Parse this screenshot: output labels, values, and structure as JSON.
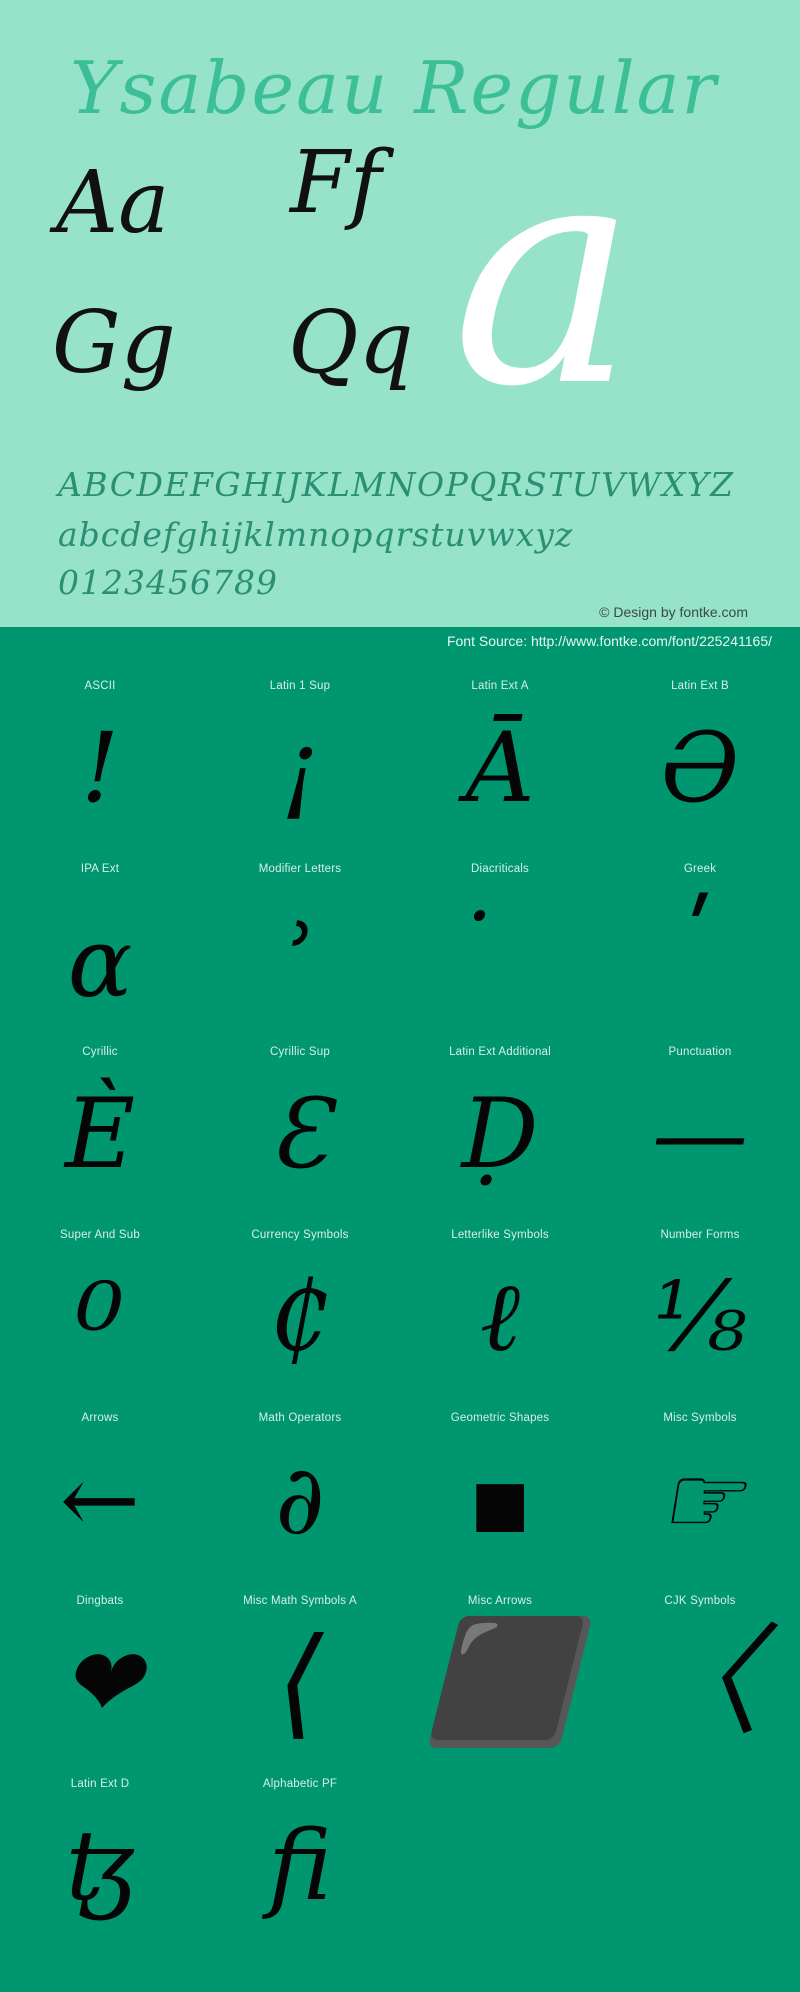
{
  "specimen": {
    "title": "Ysabeau Regular",
    "letter_pairs": [
      "Aa",
      "Ff",
      "Gg",
      "Qq"
    ],
    "feature_glyph": "a",
    "uppercase": "ABCDEFGHIJKLMNOPQRSTUVWXYZ",
    "lowercase": "abcdefghijklmnopqrstuvwxyz",
    "digits": "0123456789",
    "copyright": "© Design by fontke.com",
    "colors": {
      "panel_bg": "#96e3ca",
      "title": "#3cbf96",
      "alphabet": "#2b8f72",
      "glyph": "#111111",
      "feature_glyph": "#ffffff",
      "grid_bg": "#009770",
      "grid_label": "#d8efe6"
    }
  },
  "source_bar": {
    "text": "Font Source: http://www.fontke.com/font/225241165/"
  },
  "grid": {
    "rows": [
      [
        {
          "label": "ASCII",
          "glyph": "!",
          "size": "lg",
          "shift": ""
        },
        {
          "label": "Latin 1 Sup",
          "glyph": "¡",
          "size": "lg",
          "shift": ""
        },
        {
          "label": "Latin Ext A",
          "glyph": "Ā",
          "size": "lg",
          "shift": ""
        },
        {
          "label": "Latin Ext B",
          "glyph": "Ə",
          "size": "lg",
          "shift": ""
        }
      ],
      [
        {
          "label": "IPA Ext",
          "glyph": "ɑ",
          "size": "lg",
          "shift": "glyph-shift-down"
        },
        {
          "label": "Modifier Letters",
          "glyph": "˒",
          "size": "lg",
          "shift": "glyph-shift-up"
        },
        {
          "label": "Diacriticals",
          "glyph": "̇",
          "size": "lg",
          "shift": ""
        },
        {
          "label": "Greek",
          "glyph": "ʹ",
          "size": "lg",
          "shift": "glyph-shift-up"
        }
      ],
      [
        {
          "label": "Cyrillic",
          "glyph": "Ѐ",
          "size": "lg",
          "shift": ""
        },
        {
          "label": "Cyrillic Sup",
          "glyph": "Ɛ",
          "size": "lg",
          "shift": ""
        },
        {
          "label": "Latin Ext Additional",
          "glyph": "Ḍ",
          "size": "lg",
          "shift": ""
        },
        {
          "label": "Punctuation",
          "glyph": "—",
          "size": "lg",
          "shift": ""
        }
      ],
      [
        {
          "label": "Super And Sub",
          "glyph": "⁰",
          "size": "xl",
          "shift": "glyph-shift-down"
        },
        {
          "label": "Currency Symbols",
          "glyph": "₵",
          "size": "lg",
          "shift": ""
        },
        {
          "label": "Letterlike Symbols",
          "glyph": "ℓ",
          "size": "lg",
          "shift": ""
        },
        {
          "label": "Number Forms",
          "glyph": "⅛",
          "size": "lg",
          "shift": ""
        }
      ],
      [
        {
          "label": "Arrows",
          "glyph": "←",
          "size": "lg",
          "shift": ""
        },
        {
          "label": "Math Operators",
          "glyph": "∂",
          "size": "lg",
          "shift": ""
        },
        {
          "label": "Geometric Shapes",
          "glyph": "▪",
          "size": "lg",
          "shift": ""
        },
        {
          "label": "Misc Symbols",
          "glyph": "☞",
          "size": "lg",
          "shift": ""
        }
      ],
      [
        {
          "label": "Dingbats",
          "glyph": "❤",
          "size": "lg",
          "shift": ""
        },
        {
          "label": "Misc Math Symbols A",
          "glyph": "⟨",
          "size": "xl",
          "shift": ""
        },
        {
          "label": "Misc Arrows",
          "glyph": "⬛",
          "size": "xl",
          "shift": ""
        },
        {
          "label": "CJK Symbols",
          "glyph": "〈",
          "size": "xl",
          "shift": ""
        }
      ],
      [
        {
          "label": "Latin Ext D",
          "glyph": "ꜩ",
          "size": "lg",
          "shift": ""
        },
        {
          "label": "Alphabetic PF",
          "glyph": "ﬁ",
          "size": "lg",
          "shift": ""
        },
        {
          "label": "",
          "glyph": "",
          "size": "lg",
          "shift": ""
        },
        {
          "label": "",
          "glyph": "",
          "size": "lg",
          "shift": ""
        }
      ]
    ]
  }
}
